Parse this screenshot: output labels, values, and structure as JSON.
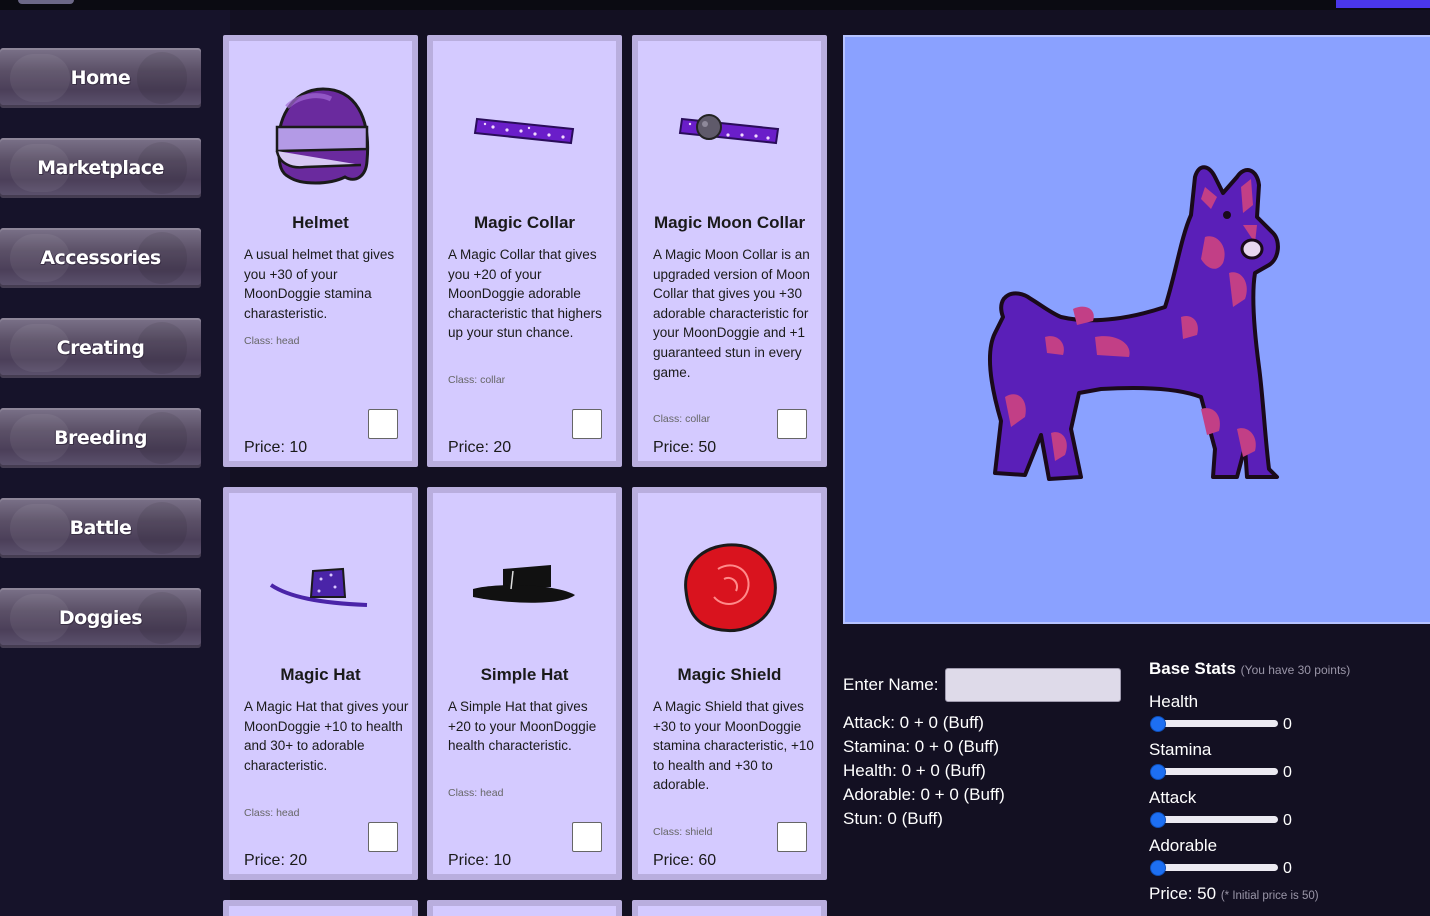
{
  "nav": {
    "items": [
      {
        "label": "Home"
      },
      {
        "label": "Marketplace"
      },
      {
        "label": "Accessories"
      },
      {
        "label": "Creating"
      },
      {
        "label": "Breeding"
      },
      {
        "label": "Battle"
      },
      {
        "label": "Doggies"
      }
    ]
  },
  "accessories": [
    {
      "title": "Helmet",
      "description": "A usual helmet that gives you +30 of your MoonDoggie stamina charasteristic.",
      "class_text": "Class: head",
      "price_text": "Price: 10",
      "icon": "helmet-icon",
      "color": "#6a2a9e"
    },
    {
      "title": "Magic Collar",
      "description": "A Magic Collar that gives you +20 of your MoonDoggie adorable characteristic that highers up your stun chance.",
      "class_text": "Class: collar",
      "price_text": "Price: 20",
      "icon": "collar-icon",
      "color": "#6a1ec9"
    },
    {
      "title": "Magic Moon Collar",
      "description": "A Magic Moon Collar is an upgraded version of Moon Collar that gives you +30 adorable characteristic for your MoonDoggie and +1 guaranteed stun in every game.",
      "class_text": "Class: collar",
      "price_text": "Price: 50",
      "icon": "moon-collar-icon",
      "color": "#6a1ec9"
    },
    {
      "title": "Magic Hat",
      "description": "A Magic Hat that gives your MoonDoggie +10 to health and 30+ to adorable characteristic.",
      "class_text": "Class: head",
      "price_text": "Price: 20",
      "icon": "magic-hat-icon",
      "color": "#4a24a8"
    },
    {
      "title": "Simple Hat",
      "description": "A Simple Hat that gives +20 to your MoonDoggie health characteristic.",
      "class_text": "Class: head",
      "price_text": "Price: 10",
      "icon": "simple-hat-icon",
      "color": "#111111"
    },
    {
      "title": "Magic Shield",
      "description": "A Magic Shield that gives +30 to your MoonDoggie stamina characteristic, +10 to health and +30 to adorable.",
      "class_text": "Class: shield",
      "price_text": "Price: 60",
      "icon": "shield-icon",
      "color": "#d9131e"
    }
  ],
  "preview": {
    "icon": "doggie-icon",
    "body_color": "#5a1fb8",
    "spot_color": "#c23f86",
    "background": "#8aa1ff"
  },
  "creator": {
    "name_label": "Enter Name:",
    "name_value": "",
    "stats": [
      "Attack: 0 + 0 (Buff)",
      "Stamina: 0 + 0 (Buff)",
      "Health: 0 + 0 (Buff)",
      "Adorable: 0 + 0 (Buff)",
      "Stun: 0 (Buff)"
    ]
  },
  "base_stats": {
    "title": "Base Stats",
    "note": "(You have 30 points)",
    "sliders": [
      {
        "label": "Health",
        "value": "0"
      },
      {
        "label": "Stamina",
        "value": "0"
      },
      {
        "label": "Attack",
        "value": "0"
      },
      {
        "label": "Adorable",
        "value": "0"
      }
    ],
    "price_text": "Price: 50",
    "price_note": "(* Initial price is 50)"
  }
}
